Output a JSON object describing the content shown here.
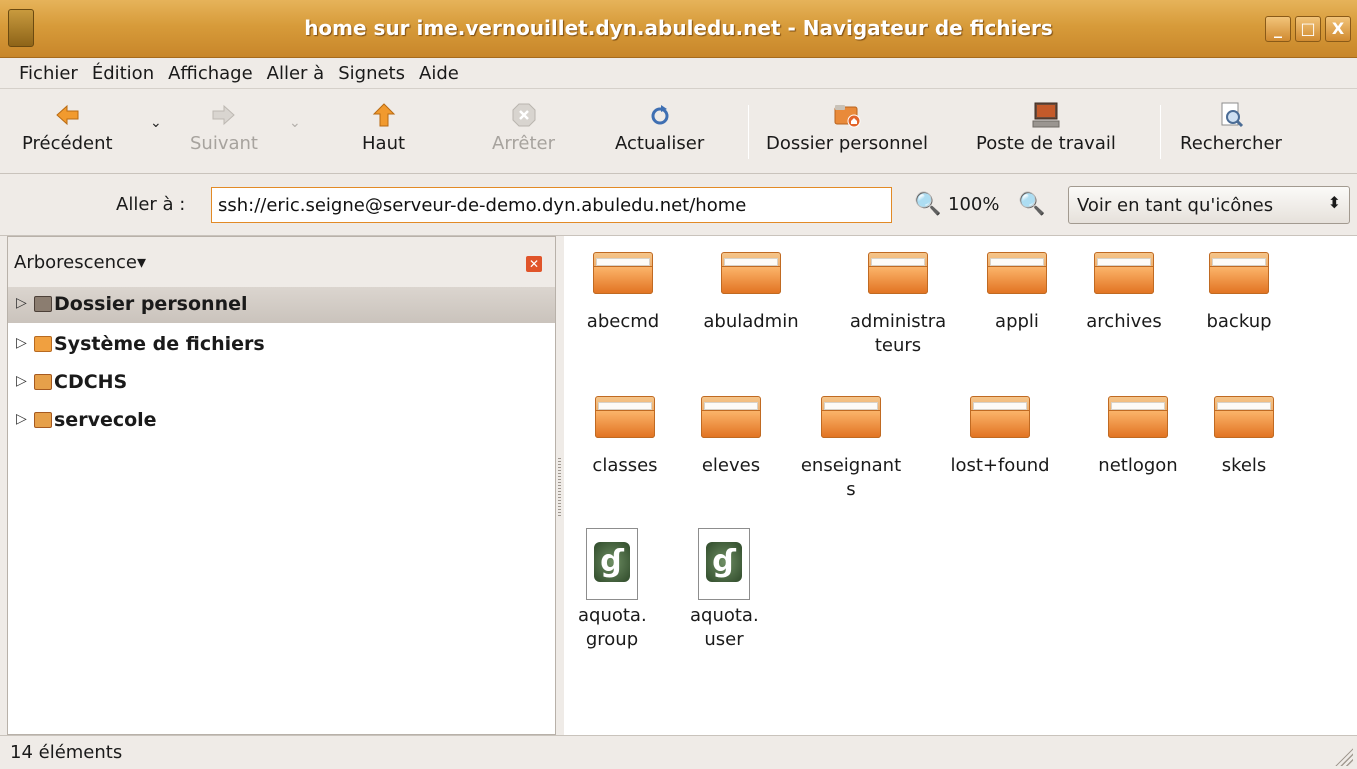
{
  "window": {
    "title": "home sur ime.vernouillet.dyn.abuledu.net - Navigateur de fichiers",
    "minimize": "_",
    "maximize": "□",
    "close": "X"
  },
  "menu": [
    "Fichier",
    "Édition",
    "Affichage",
    "Aller à",
    "Signets",
    "Aide"
  ],
  "toolbar": {
    "back": "Précédent",
    "forward": "Suivant",
    "up": "Haut",
    "stop": "Arrêter",
    "reload": "Actualiser",
    "home": "Dossier personnel",
    "computer": "Poste de travail",
    "search": "Rechercher",
    "dropdown_arrow": "⌄"
  },
  "location": {
    "label": "Aller à :",
    "value": "ssh://eric.seigne@serveur-de-demo.dyn.abuledu.net/home",
    "zoom_out_icon": "🔍",
    "zoom": "100%",
    "zoom_in_icon": "🔍",
    "view_mode": "Voir en tant qu'icônes",
    "view_arrow": "⬍"
  },
  "sidepane": {
    "title": "Arborescence",
    "title_arrow": "▾",
    "close": "✕",
    "expander": "▷",
    "items": [
      {
        "label": "Dossier personnel",
        "selected": true
      },
      {
        "label": "Système de fichiers",
        "selected": false
      },
      {
        "label": "CDCHS",
        "selected": false
      },
      {
        "label": "servecole",
        "selected": false
      }
    ]
  },
  "files": [
    {
      "name": "abecmd",
      "type": "folder"
    },
    {
      "name": "abuladmin",
      "type": "folder"
    },
    {
      "name": "administra\nteurs",
      "type": "folder"
    },
    {
      "name": "appli",
      "type": "folder"
    },
    {
      "name": "archives",
      "type": "folder"
    },
    {
      "name": "backup",
      "type": "folder"
    },
    {
      "name": "classes",
      "type": "folder"
    },
    {
      "name": "eleves",
      "type": "folder"
    },
    {
      "name": "enseignant\ns",
      "type": "folder"
    },
    {
      "name": "lost+found",
      "type": "folder"
    },
    {
      "name": "netlogon",
      "type": "folder"
    },
    {
      "name": "skels",
      "type": "folder"
    },
    {
      "name": "aquota.\ngroup",
      "type": "file"
    },
    {
      "name": "aquota.\nuser",
      "type": "file"
    }
  ],
  "file_badge_glyph": "ɠ",
  "status": "14 éléments",
  "colors": {
    "titlebar": "#d79b3a",
    "folder": "#f39a4a",
    "focus_border": "#e28a26",
    "selected_row": "#d4cec8"
  }
}
